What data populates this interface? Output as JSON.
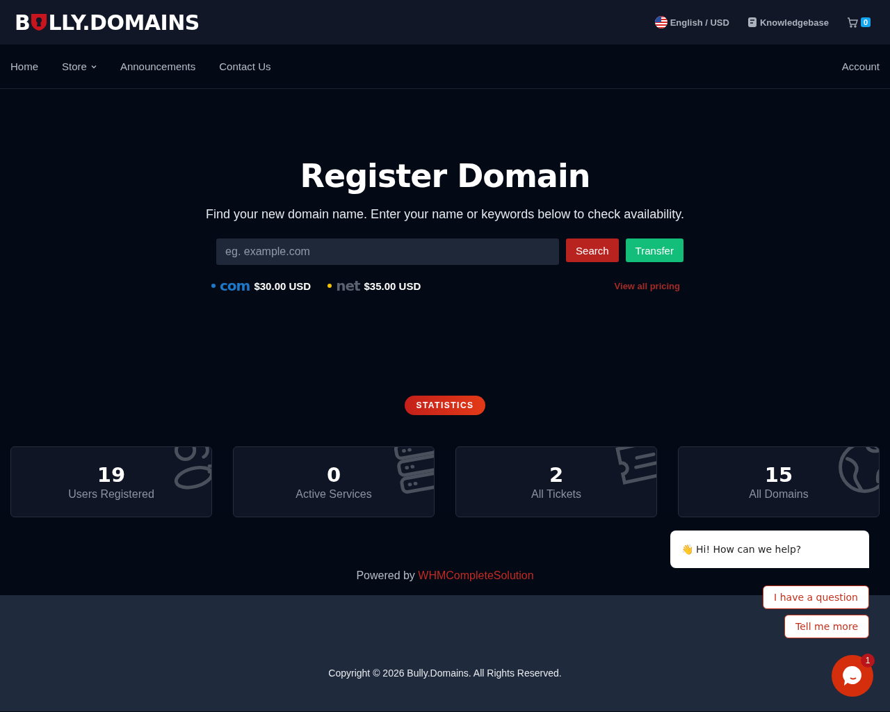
{
  "logo": {
    "prefix": "B",
    "suffix": "LLY.DOMAINS"
  },
  "topbar": {
    "language": "English / USD",
    "knowledgebase": "Knowledgebase",
    "cart_count": "0"
  },
  "nav": {
    "items": [
      {
        "label": "Home",
        "dropdown": false
      },
      {
        "label": "Store",
        "dropdown": true
      },
      {
        "label": "Announcements",
        "dropdown": false
      },
      {
        "label": "Contact Us",
        "dropdown": false
      }
    ],
    "account": "Account"
  },
  "hero": {
    "title": "Register Domain",
    "subtitle": "Find your new domain name. Enter your name or keywords below to check availability.",
    "search": {
      "placeholder": "eg. example.com"
    },
    "buttons": [
      {
        "label": "Search",
        "kind": "search"
      },
      {
        "label": "Transfer",
        "kind": "transfer"
      }
    ],
    "tlds": [
      {
        "name": "com",
        "price": "$30.00 USD",
        "color": "#1e78c8"
      },
      {
        "name": "net",
        "price": "$35.00 USD",
        "color": "#f2c200"
      }
    ],
    "pricing_link": "View all pricing"
  },
  "statistics": {
    "badge": "STATISTICS",
    "cards": [
      {
        "value": "19",
        "label": "Users Registered",
        "kind": "users"
      },
      {
        "value": "0",
        "label": "Active Services",
        "kind": "servers"
      },
      {
        "value": "2",
        "label": "All Tickets",
        "kind": "ticket"
      },
      {
        "value": "15",
        "label": "All Domains",
        "kind": "globe"
      }
    ]
  },
  "powered": {
    "prefix": "Powered by",
    "link": "WHMCompleteSolution"
  },
  "footer": {
    "copyright": "Copyright © 2026 Bully.Domains. All Rights Reserved."
  },
  "chat": {
    "greeting_emoji": "👋",
    "greeting": "Hi! How can we help?",
    "options": [
      "I have a question",
      "Tell me more"
    ],
    "unread": "1"
  }
}
